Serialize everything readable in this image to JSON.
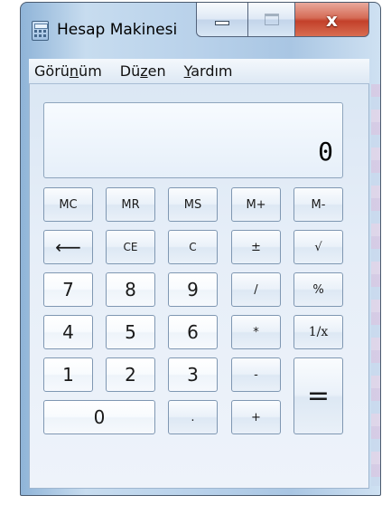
{
  "window": {
    "title": "Hesap Makinesi",
    "close_glyph": "x"
  },
  "menu": {
    "items": [
      {
        "pre": "Görü",
        "u": "n",
        "post": "üm"
      },
      {
        "pre": "Dü",
        "u": "z",
        "post": "en"
      },
      {
        "pre": "",
        "u": "Y",
        "post": "ardım"
      }
    ]
  },
  "display": {
    "value": "0"
  },
  "keys": {
    "mc": "MC",
    "mr": "MR",
    "ms": "MS",
    "mplus": "M+",
    "mminus": "M-",
    "back": "⟵",
    "ce": "CE",
    "c": "C",
    "neg": "±",
    "sqrt": "√",
    "n7": "7",
    "n8": "8",
    "n9": "9",
    "div": "/",
    "pct": "%",
    "n4": "4",
    "n5": "5",
    "n6": "6",
    "mul": "*",
    "recip": "1/x",
    "n1": "1",
    "n2": "2",
    "n3": "3",
    "sub": "-",
    "eq": "=",
    "n0": "0",
    "dot": ".",
    "add": "+"
  },
  "colors": {
    "close_button": "#c3402a",
    "frame": "#b8d1ea",
    "client": "#e6eef8"
  }
}
